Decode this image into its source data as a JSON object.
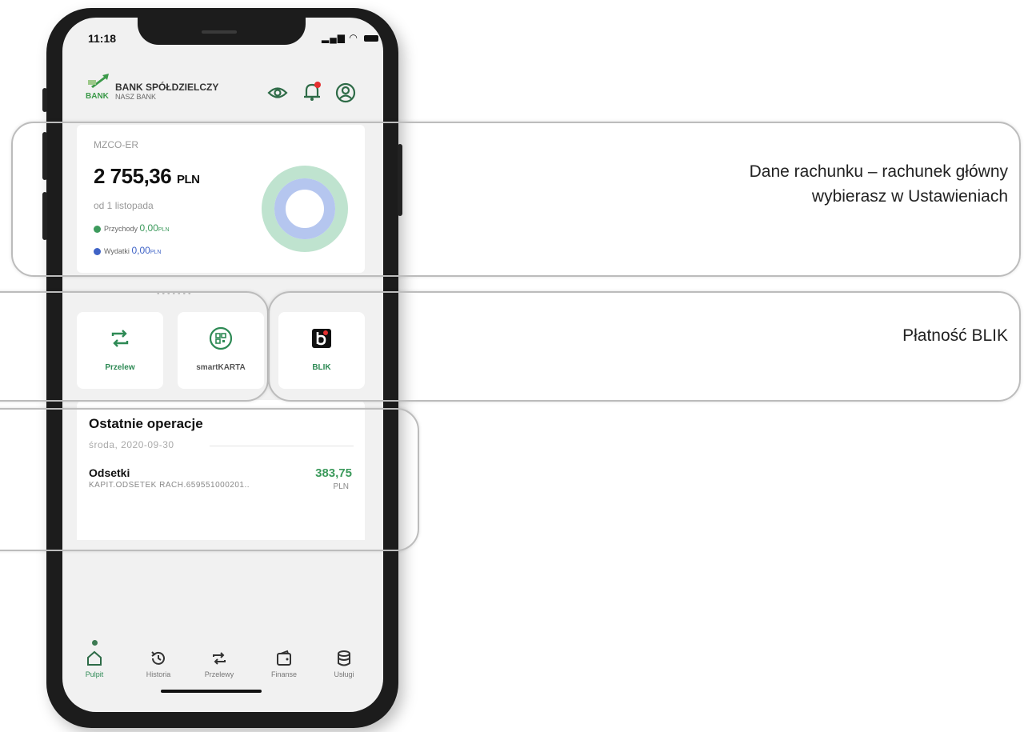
{
  "status_bar": {
    "time": "11:18"
  },
  "header": {
    "logo_line1": "BANK SPÓŁDZIELCZY",
    "logo_line2": "NASZ BANK",
    "logo_word": "BANK",
    "icons": [
      "eye-icon",
      "bell-icon",
      "profile-icon"
    ]
  },
  "account": {
    "name": "MZCO-ER",
    "balance": "2 755,36",
    "currency": "PLN",
    "since": "od 1 listopada",
    "income_label": "Przychody",
    "income_value": "0,00",
    "income_currency": "PLN",
    "expense_label": "Wydatki",
    "expense_value": "0,00",
    "expense_currency": "PLN",
    "pager": "•••••••"
  },
  "tiles": [
    {
      "label": "Przelew",
      "icon": "transfer-icon"
    },
    {
      "label": "smartKARTA",
      "icon": "qr-icon"
    },
    {
      "label": "BLIK",
      "icon": "blik-icon"
    }
  ],
  "operations": {
    "title": "Ostatnie operacje",
    "date": "środa, 2020-09-30",
    "items": [
      {
        "title": "Odsetki",
        "description": "KAPIT.ODSETEK RACH.659551000201..",
        "amount": "383,75",
        "currency": "PLN"
      }
    ]
  },
  "bottom_nav": [
    {
      "label": "Pulpit",
      "icon": "home-icon"
    },
    {
      "label": "Historia",
      "icon": "history-icon"
    },
    {
      "label": "Przelewy",
      "icon": "transfer-icon"
    },
    {
      "label": "Finanse",
      "icon": "wallet-icon"
    },
    {
      "label": "Usługi",
      "icon": "database-icon"
    }
  ],
  "annotations": {
    "account_line1": "Dane rachunku – rachunek główny",
    "account_line2": "wybierasz w Ustawieniach",
    "blik": "Płatność BLIK"
  },
  "colors": {
    "brand_green": "#3c9a5c",
    "donut_outer": "#bfe3cf",
    "donut_inner": "#b5c6ef",
    "blik_red": "#e53030"
  }
}
